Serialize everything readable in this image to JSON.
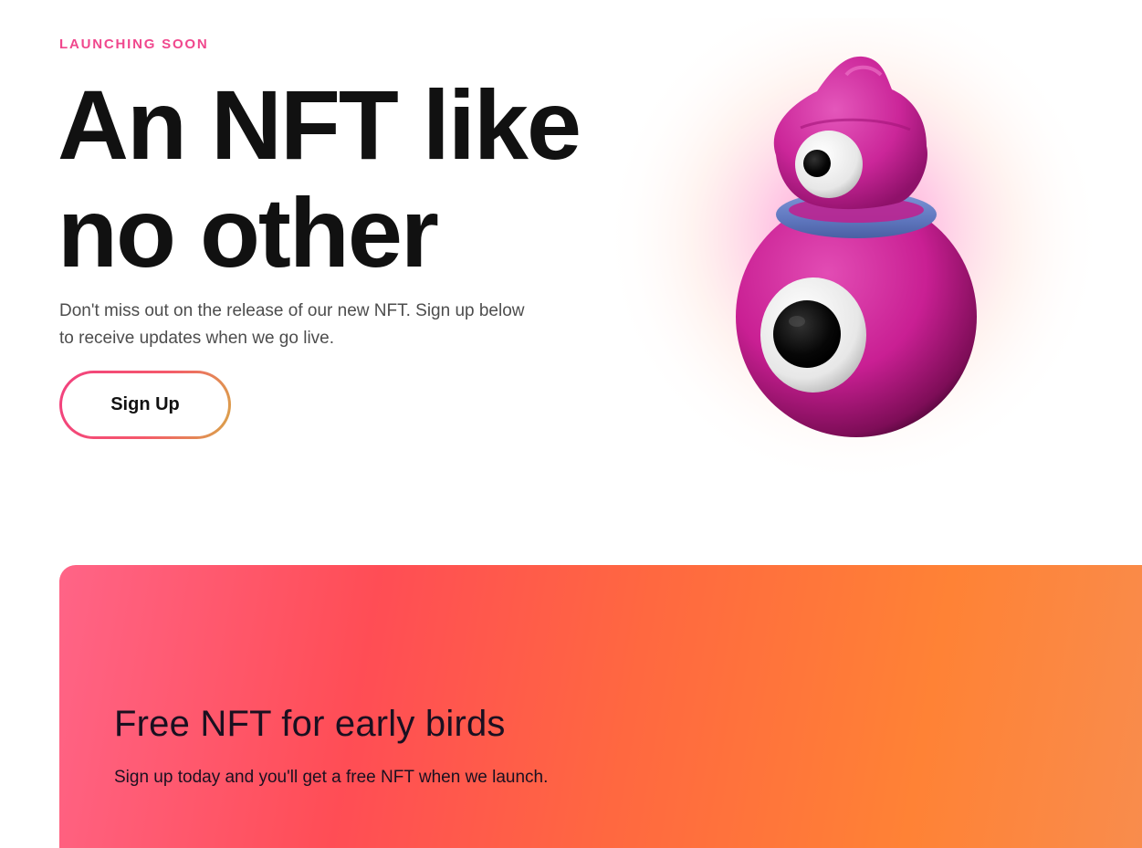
{
  "hero": {
    "eyebrow": "LAUNCHING SOON",
    "title_line1": "An NFT like",
    "title_line2": "no other",
    "description": "Don't miss out on the release of our new NFT. Sign up below to receive updates when we go live.",
    "cta_label": "Sign Up",
    "illustration": "pink-cyclops-character-icon"
  },
  "promo": {
    "title": "Free NFT for early birds",
    "description": "Sign up today and you'll get a free NFT when we launch."
  },
  "colors": {
    "accent_pink": "#f0478d",
    "heading": "#111111",
    "body_text": "#4d4d4d",
    "character_magenta": "#d42a9e",
    "character_collar": "#6a82c8",
    "promo_gradient_start": "#ff6487",
    "promo_gradient_end": "#f88d4e"
  }
}
